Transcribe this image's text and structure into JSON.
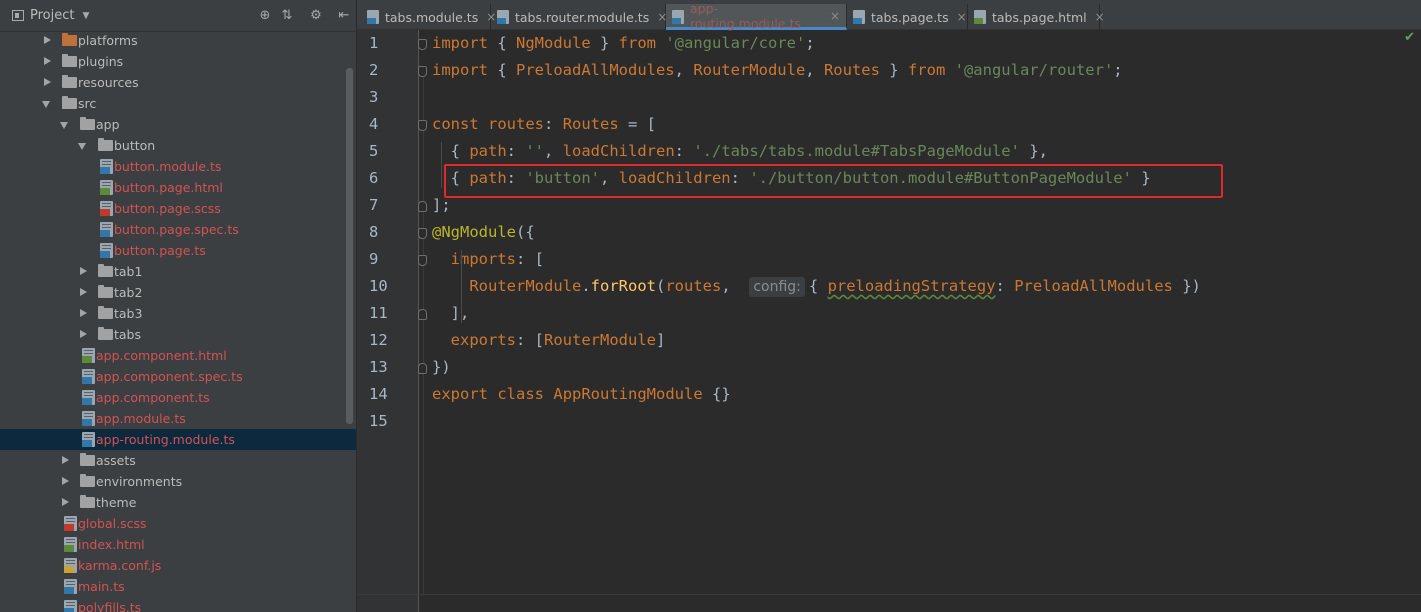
{
  "project": {
    "title": "Project",
    "tree": [
      {
        "label": "platforms",
        "depth": 1,
        "type": "folder",
        "expanded": false,
        "color": "orange"
      },
      {
        "label": "plugins",
        "depth": 1,
        "type": "folder",
        "expanded": false
      },
      {
        "label": "resources",
        "depth": 1,
        "type": "folder",
        "expanded": false
      },
      {
        "label": "src",
        "depth": 1,
        "type": "folder",
        "expanded": true
      },
      {
        "label": "app",
        "depth": 2,
        "type": "folder",
        "expanded": true
      },
      {
        "label": "button",
        "depth": 3,
        "type": "folder",
        "expanded": true
      },
      {
        "label": "button.module.ts",
        "depth": 4,
        "type": "ts",
        "modified": true
      },
      {
        "label": "button.page.html",
        "depth": 4,
        "type": "html",
        "modified": true
      },
      {
        "label": "button.page.scss",
        "depth": 4,
        "type": "scss",
        "modified": true
      },
      {
        "label": "button.page.spec.ts",
        "depth": 4,
        "type": "ts",
        "modified": true
      },
      {
        "label": "button.page.ts",
        "depth": 4,
        "type": "ts",
        "modified": true
      },
      {
        "label": "tab1",
        "depth": 3,
        "type": "folder",
        "expanded": false
      },
      {
        "label": "tab2",
        "depth": 3,
        "type": "folder",
        "expanded": false
      },
      {
        "label": "tab3",
        "depth": 3,
        "type": "folder",
        "expanded": false
      },
      {
        "label": "tabs",
        "depth": 3,
        "type": "folder",
        "expanded": false
      },
      {
        "label": "app.component.html",
        "depth": 3,
        "type": "html",
        "modified": true
      },
      {
        "label": "app.component.spec.ts",
        "depth": 3,
        "type": "ts",
        "modified": true
      },
      {
        "label": "app.component.ts",
        "depth": 3,
        "type": "ts",
        "modified": true
      },
      {
        "label": "app.module.ts",
        "depth": 3,
        "type": "ts",
        "modified": true
      },
      {
        "label": "app-routing.module.ts",
        "depth": 3,
        "type": "ts",
        "modified": true,
        "selected": true
      },
      {
        "label": "assets",
        "depth": 2,
        "type": "folder",
        "expanded": false
      },
      {
        "label": "environments",
        "depth": 2,
        "type": "folder",
        "expanded": false
      },
      {
        "label": "theme",
        "depth": 2,
        "type": "folder",
        "expanded": false
      },
      {
        "label": "global.scss",
        "depth": 2,
        "type": "scss",
        "modified": true
      },
      {
        "label": "index.html",
        "depth": 2,
        "type": "html",
        "modified": true
      },
      {
        "label": "karma.conf.js",
        "depth": 2,
        "type": "js",
        "modified": true
      },
      {
        "label": "main.ts",
        "depth": 2,
        "type": "ts",
        "modified": true
      },
      {
        "label": "polyfills.ts",
        "depth": 2,
        "type": "ts",
        "modified": true
      }
    ]
  },
  "tabs": [
    {
      "label": "tabs.module.ts",
      "type": "ts",
      "active": false
    },
    {
      "label": "tabs.router.module.ts",
      "type": "ts",
      "active": false
    },
    {
      "label": "app-routing.module.ts",
      "type": "ts",
      "active": true
    },
    {
      "label": "tabs.page.ts",
      "type": "ts",
      "active": false
    },
    {
      "label": "tabs.page.html",
      "type": "html",
      "active": false
    }
  ],
  "editor": {
    "line_numbers": [
      "1",
      "2",
      "3",
      "4",
      "5",
      "6",
      "7",
      "8",
      "9",
      "10",
      "11",
      "12",
      "13",
      "14",
      "15"
    ],
    "inlay_hint": "config:",
    "code": {
      "l1": [
        "import",
        " { ",
        "NgModule",
        " } ",
        "from",
        " ",
        "'@angular/core'",
        ";"
      ],
      "l2": [
        "import",
        " { ",
        "PreloadAllModules",
        ", ",
        "RouterModule",
        ", ",
        "Routes",
        " } ",
        "from",
        " ",
        "'@angular/router'",
        ";"
      ],
      "l4": [
        "const",
        " ",
        "routes",
        ": ",
        "Routes",
        " = ["
      ],
      "l5": [
        "  { ",
        "path",
        ": ",
        "''",
        ", ",
        "loadChildren",
        ": ",
        "'./tabs/tabs.module#TabsPageModule'",
        " },"
      ],
      "l6": [
        "  { ",
        "path",
        ": ",
        "'button'",
        ", ",
        "loadChildren",
        ": ",
        "'./button/button.module#ButtonPageModule'",
        " }"
      ],
      "l7": [
        "];"
      ],
      "l8": [
        "@NgModule",
        "({"
      ],
      "l9": [
        "  ",
        "imports",
        ": ["
      ],
      "l10": [
        "    ",
        "RouterModule",
        ".",
        "forRoot",
        "(",
        "routes",
        ",  ",
        "{ ",
        "preloadingStrategy",
        ": ",
        "PreloadAllModules",
        " })"
      ],
      "l11": [
        "  ],"
      ],
      "l12": [
        "  ",
        "exports",
        ": [",
        "RouterModule",
        "]"
      ],
      "l13": [
        "})"
      ],
      "l14": [
        "export",
        " ",
        "class",
        " ",
        "AppRoutingModule",
        " {}"
      ]
    }
  }
}
